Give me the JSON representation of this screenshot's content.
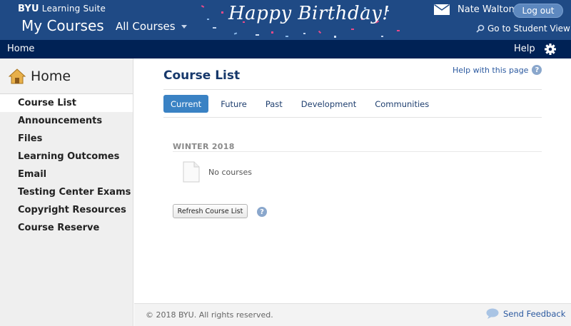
{
  "header": {
    "brand_strong": "BYU",
    "brand_rest": "Learning Suite",
    "app_title": "My Courses",
    "course_selector": "All Courses",
    "banner_message": "Happy Birthday!",
    "user_name": "Nate Walton",
    "logout_label": "Log out",
    "student_view_label": "Go to Student View"
  },
  "navbar": {
    "home_label": "Home",
    "help_label": "Help"
  },
  "sidebar": {
    "heading": "Home",
    "items": [
      {
        "label": "Course List"
      },
      {
        "label": "Announcements"
      },
      {
        "label": "Files"
      },
      {
        "label": "Learning Outcomes"
      },
      {
        "label": "Email"
      },
      {
        "label": "Testing Center Exams"
      },
      {
        "label": "Copyright Resources"
      },
      {
        "label": "Course Reserve"
      }
    ]
  },
  "main": {
    "title": "Course List",
    "help_link": "Help with this page",
    "help_icon": "?",
    "tabs": [
      {
        "label": "Current"
      },
      {
        "label": "Future"
      },
      {
        "label": "Past"
      },
      {
        "label": "Development"
      },
      {
        "label": "Communities"
      }
    ],
    "term_label": "WINTER 2018",
    "empty_text": "No courses",
    "refresh_label": "Refresh Course List"
  },
  "footer": {
    "copyright": "© 2018 BYU. All rights reserved.",
    "feedback_label": "Send Feedback"
  },
  "colors": {
    "banner": "#1f4a85",
    "navbar": "#002255",
    "accent": "#3a82c4",
    "link": "#2c5aa0"
  },
  "icons": [
    "mail-icon",
    "search-icon",
    "gear-icon",
    "house-icon",
    "help-icon",
    "document-icon",
    "chat-bubble-icon"
  ]
}
